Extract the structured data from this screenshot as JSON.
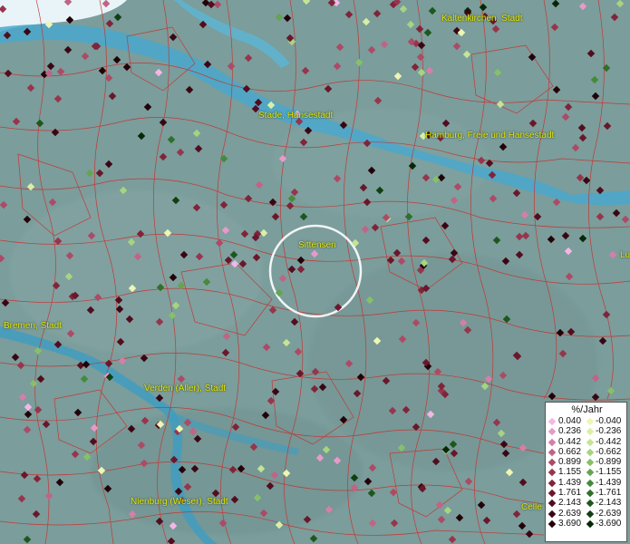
{
  "places": [
    {
      "id": "kaltenkirchen",
      "name": "Kaltenkirchen, Stadt"
    },
    {
      "id": "stade",
      "name": "Stade, Hansestadt"
    },
    {
      "id": "hamburg",
      "name": "Hamburg, Freie und Hansestadt"
    },
    {
      "id": "sittensen",
      "name": "Sittensen"
    },
    {
      "id": "bremen",
      "name": "Bremen, Stadt"
    },
    {
      "id": "verden",
      "name": "Verden (Aller), Stadt"
    },
    {
      "id": "nienburg",
      "name": "Nienburg (Weser), Stadt"
    },
    {
      "id": "celle",
      "name": "Celle"
    },
    {
      "id": "partial-right",
      "name": "Lu"
    }
  ],
  "legend": {
    "title": "%/Jahr",
    "rows": [
      {
        "pos": "0.040",
        "neg": "-0.040",
        "pos_color": "#f4b6e6",
        "neg_color": "#eef6b4"
      },
      {
        "pos": "0.236",
        "neg": "-0.236",
        "pos_color": "#e79ac9",
        "neg_color": "#d9efa6"
      },
      {
        "pos": "0.442",
        "neg": "-0.442",
        "pos_color": "#d57ea9",
        "neg_color": "#c4e496"
      },
      {
        "pos": "0.662",
        "neg": "-0.662",
        "pos_color": "#c26386",
        "neg_color": "#a6d480"
      },
      {
        "pos": "0.899",
        "neg": "-0.899",
        "pos_color": "#ad4a66",
        "neg_color": "#86c06a"
      },
      {
        "pos": "1.155",
        "neg": "-1.155",
        "pos_color": "#97354d",
        "neg_color": "#63a550"
      },
      {
        "pos": "1.439",
        "neg": "-1.439",
        "pos_color": "#80243a",
        "neg_color": "#468a3c"
      },
      {
        "pos": "1.761",
        "neg": "-1.761",
        "pos_color": "#6a172b",
        "neg_color": "#2f702b"
      },
      {
        "pos": "2.143",
        "neg": "-2.143",
        "pos_color": "#520d1e",
        "neg_color": "#1d571d"
      },
      {
        "pos": "2.639",
        "neg": "-2.639",
        "pos_color": "#3a0613",
        "neg_color": "#103f11"
      },
      {
        "pos": "3.690",
        "neg": "-3.690",
        "pos_color": "#220208",
        "neg_color": "#062807"
      }
    ]
  }
}
